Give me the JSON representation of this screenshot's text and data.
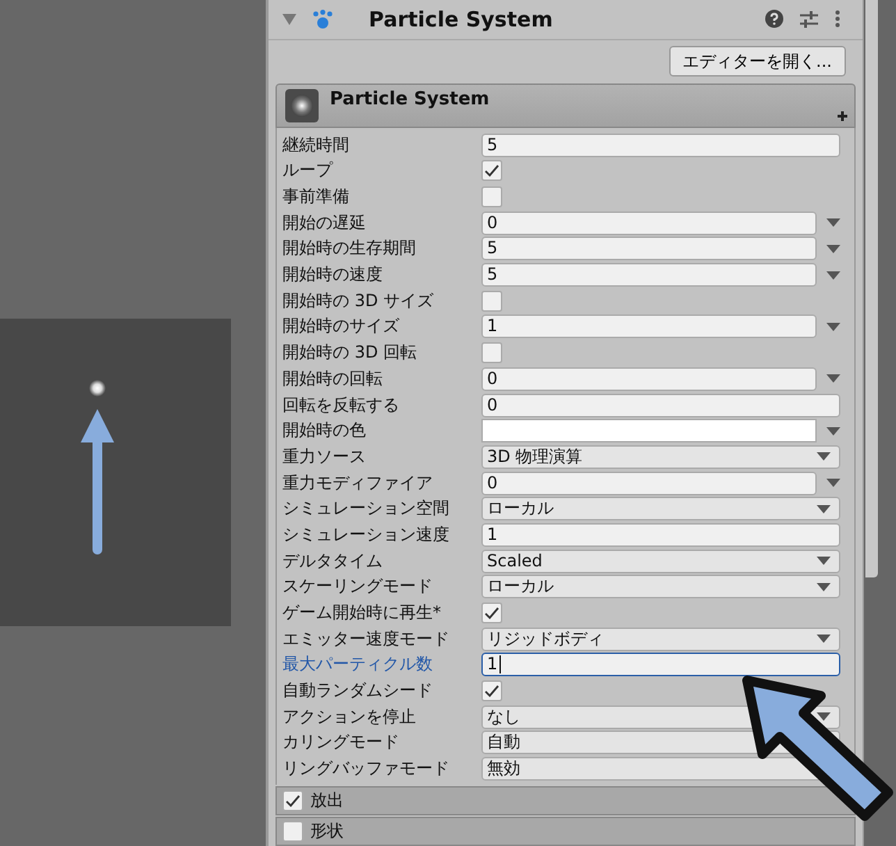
{
  "header": {
    "title": "Particle System"
  },
  "open_editor_button": "エディターを開く...",
  "module": {
    "title": "Particle System"
  },
  "properties": [
    {
      "label": "継続時間",
      "kind": "text",
      "value": "5",
      "focused": false
    },
    {
      "label": "ループ",
      "kind": "checkbox",
      "checked": true,
      "focused": false
    },
    {
      "label": "事前準備",
      "kind": "checkbox",
      "checked": false,
      "focused": false
    },
    {
      "label": "開始の遅延",
      "kind": "curve",
      "value": "0",
      "focused": false
    },
    {
      "label": "開始時の生存期間",
      "kind": "curve",
      "value": "5",
      "focused": false
    },
    {
      "label": "開始時の速度",
      "kind": "curve",
      "value": "5",
      "focused": false
    },
    {
      "label": "開始時の 3D サイズ",
      "kind": "checkbox",
      "checked": false,
      "focused": false
    },
    {
      "label": "開始時のサイズ",
      "kind": "curve",
      "value": "1",
      "focused": false
    },
    {
      "label": "開始時の 3D 回転",
      "kind": "checkbox",
      "checked": false,
      "focused": false
    },
    {
      "label": "開始時の回転",
      "kind": "curve",
      "value": "0",
      "focused": false
    },
    {
      "label": "回転を反転する",
      "kind": "text",
      "value": "0",
      "focused": false
    },
    {
      "label": "開始時の色",
      "kind": "color",
      "color": "#ffffff",
      "focused": false
    },
    {
      "label": "重力ソース",
      "kind": "dropdown",
      "value": "3D 物理演算",
      "focused": false
    },
    {
      "label": "重力モディファイア",
      "kind": "curve",
      "value": "0",
      "focused": false
    },
    {
      "label": "シミュレーション空間",
      "kind": "dropdown",
      "value": "ローカル",
      "focused": false
    },
    {
      "label": "シミュレーション速度",
      "kind": "text",
      "value": "1",
      "focused": false
    },
    {
      "label": "デルタタイム",
      "kind": "dropdown",
      "value": "Scaled",
      "focused": false
    },
    {
      "label": "スケーリングモード",
      "kind": "dropdown",
      "value": "ローカル",
      "focused": false
    },
    {
      "label": "ゲーム開始時に再生*",
      "kind": "checkbox",
      "checked": true,
      "focused": false
    },
    {
      "label": "エミッター速度モード",
      "kind": "dropdown",
      "value": "リジッドボディ",
      "focused": false
    },
    {
      "label": "最大パーティクル数",
      "kind": "text",
      "value": "1",
      "focused": true
    },
    {
      "label": "自動ランダムシード",
      "kind": "checkbox",
      "checked": true,
      "focused": false
    },
    {
      "label": "アクションを停止",
      "kind": "dropdown",
      "value": "なし",
      "focused": false
    },
    {
      "label": "カリングモード",
      "kind": "dropdown",
      "value": "自動",
      "focused": false
    },
    {
      "label": "リングバッファモード",
      "kind": "dropdown",
      "value": "無効",
      "focused": false
    }
  ],
  "modules": [
    {
      "label": "放出",
      "checked": true
    },
    {
      "label": "形状",
      "checked": false
    }
  ]
}
